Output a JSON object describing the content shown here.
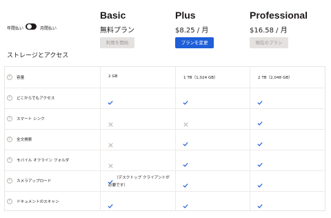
{
  "toggle": {
    "left_label": "年間払い",
    "right_label": "月間払い"
  },
  "plans": [
    {
      "name": "Basic",
      "price": "無料プラン",
      "button": "利用を開始",
      "button_style": "disabled"
    },
    {
      "name": "Plus",
      "price": "$8.25 / 月",
      "button": "プランを変更",
      "button_style": "primary"
    },
    {
      "name": "Professional",
      "price": "$16.58 / 月",
      "button": "現在のプラン",
      "button_style": "disabled"
    }
  ],
  "section_title": "ストレージとアクセス",
  "info_icon_glyph": "i",
  "rows": [
    {
      "feature": "容量",
      "cells": [
        {
          "type": "text",
          "value": "2 GB"
        },
        {
          "type": "text",
          "value": "1 TB（1,024 GB）"
        },
        {
          "type": "text",
          "value": "2 TB（2,048 GB）"
        }
      ]
    },
    {
      "feature": "どこからでもアクセス",
      "cells": [
        {
          "type": "check"
        },
        {
          "type": "check"
        },
        {
          "type": "check"
        }
      ]
    },
    {
      "feature": "スマート シンク",
      "cells": [
        {
          "type": "cross"
        },
        {
          "type": "cross"
        },
        {
          "type": "check"
        }
      ]
    },
    {
      "feature": "全文検索",
      "cells": [
        {
          "type": "cross"
        },
        {
          "type": "check"
        },
        {
          "type": "check"
        }
      ]
    },
    {
      "feature": "モバイル オフライン フォルダ",
      "cells": [
        {
          "type": "cross"
        },
        {
          "type": "check"
        },
        {
          "type": "check"
        }
      ]
    },
    {
      "feature": "カメラアップロード",
      "cells": [
        {
          "type": "check",
          "note_line1": "（デスクトップ クライアントが",
          "note_line2": "必要です）"
        },
        {
          "type": "check"
        },
        {
          "type": "check"
        }
      ]
    },
    {
      "feature": "ドキュメントのスキャン",
      "cells": [
        {
          "type": "check"
        },
        {
          "type": "check"
        },
        {
          "type": "check"
        }
      ]
    }
  ],
  "colors": {
    "check": "#1f5fd8",
    "cross": "#b9b4b0",
    "primary": "#1f5fd8"
  }
}
